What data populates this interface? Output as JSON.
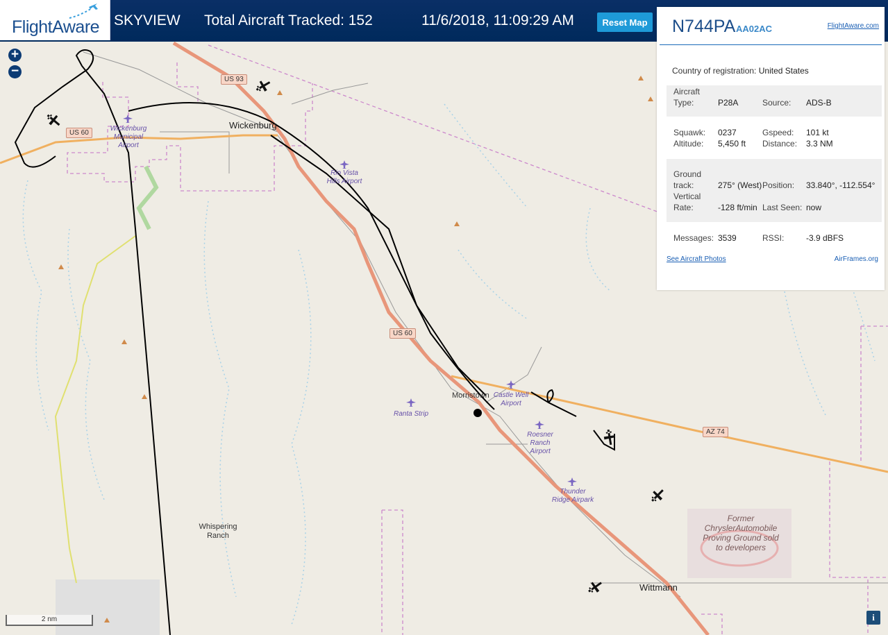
{
  "header": {
    "logo_text": "FlightAware",
    "app_name": "SKYVIEW",
    "total_tracked": "Total Aircraft Tracked: 152",
    "datetime": "11/6/2018, 11:09:29 AM",
    "reset_label": "Reset Map"
  },
  "map": {
    "zoom_in": "+",
    "zoom_out": "−",
    "towns": [
      "Wickenburg",
      "Morristown",
      "Wittmann",
      "Whispering Ranch"
    ],
    "airports": [
      "Wickenburg Municipal Airport",
      "Rio Vista Hills Airport",
      "Castle Well Airport",
      "Ranta Strip",
      "Roesner Ranch Airport",
      "Thunder Ridge Airpark"
    ],
    "highway_shields": [
      "US 93",
      "US 60",
      "US 60",
      "AZ 74"
    ],
    "proving_ground": "Former ChryslerAutomobile Proving Ground sold to developers",
    "scale": "2 nm",
    "info": "i"
  },
  "panel": {
    "registration": "N744PA",
    "hex": "AA02AC",
    "fa_link": "FlightAware.com",
    "country_label": "Country of registration:",
    "country": "United States",
    "aircraft_type_label": "Aircraft Type:",
    "aircraft_type": "P28A",
    "source_label": "Source:",
    "source": "ADS-B",
    "squawk_label": "Squawk:",
    "squawk": "0237",
    "gspeed_label": "Gspeed:",
    "gspeed": "101 kt",
    "altitude_label": "Altitude:",
    "altitude": "5,450 ft",
    "distance_label": "Distance:",
    "distance": "3.3 NM",
    "ground_track_label": "Ground track:",
    "ground_track": "275° (West)",
    "position_label": "Position:",
    "position": "33.840°, -112.554°",
    "vrate_label": "Vertical Rate:",
    "vrate": "-128 ft/min",
    "last_seen_label": "Last Seen:",
    "last_seen": "now",
    "messages_label": "Messages:",
    "messages": "3539",
    "rssi_label": "RSSI:",
    "rssi": "-3.9 dBFS",
    "photos_link": "See Aircraft Photos",
    "airframes_link": "AirFrames.org"
  },
  "colors": {
    "header_bg": "#0a2f66",
    "button": "#1e9ad8",
    "highway": "#e8967a",
    "state_route": "#f0b060",
    "boundary": "#cc88cc",
    "water": "#a8d2e8",
    "track": "#000000"
  }
}
